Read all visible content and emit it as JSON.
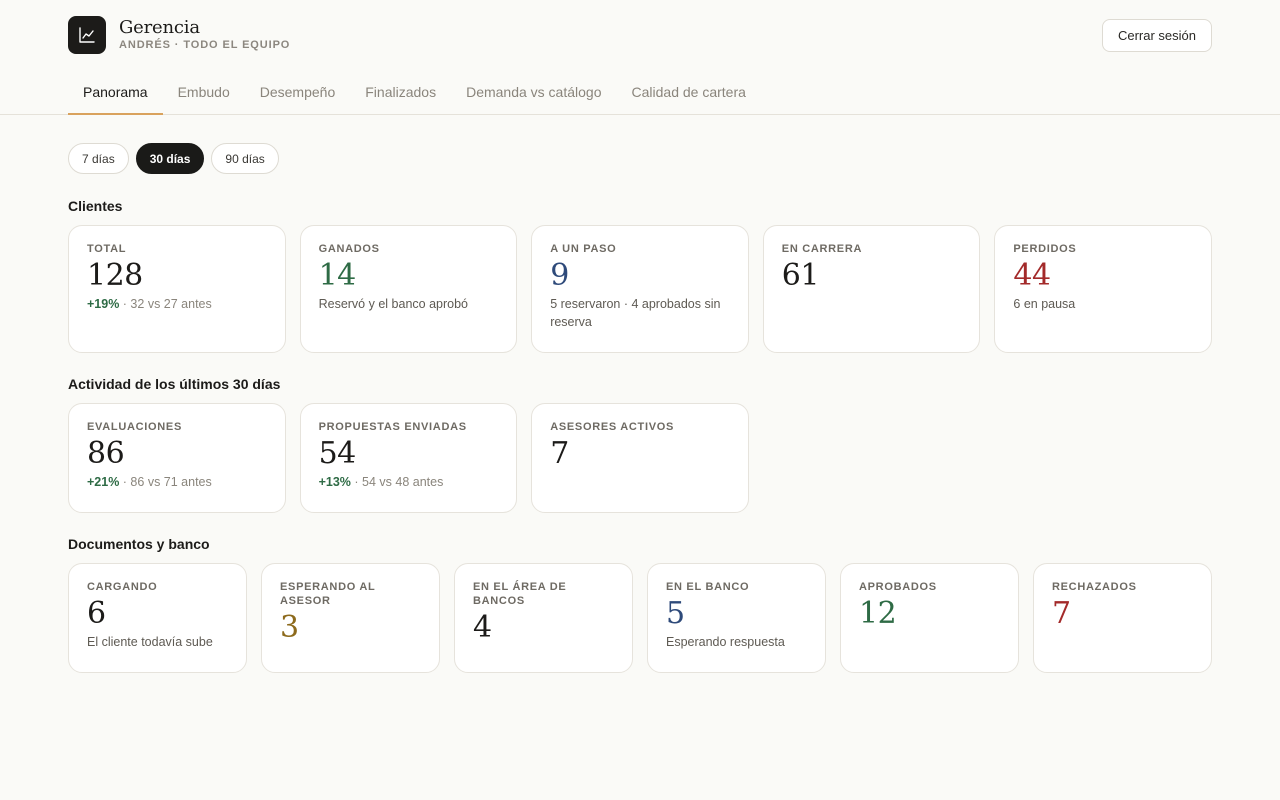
{
  "header": {
    "title": "Gerencia",
    "subtitle": "ANDRÉS · TODO EL EQUIPO",
    "logo_icon": "line-chart-icon",
    "logout_label": "Cerrar sesión"
  },
  "tabs": [
    {
      "label": "Panorama",
      "active": true
    },
    {
      "label": "Embudo",
      "active": false
    },
    {
      "label": "Desempeño",
      "active": false
    },
    {
      "label": "Finalizados",
      "active": false
    },
    {
      "label": "Demanda vs catálogo",
      "active": false
    },
    {
      "label": "Calidad de cartera",
      "active": false
    }
  ],
  "ranges": [
    {
      "label": "7 días",
      "active": false
    },
    {
      "label": "30 días",
      "active": true
    },
    {
      "label": "90 días",
      "active": false
    }
  ],
  "clientes": {
    "title": "Clientes",
    "cards": [
      {
        "label": "TOTAL",
        "value": "128",
        "delta": "+19%",
        "detail": " · 32 vs 27 antes"
      },
      {
        "label": "GANADOS",
        "value": "14",
        "note": "Reservó y el banco aprobó"
      },
      {
        "label": "A UN PASO",
        "value": "9",
        "note": "5 reservaron · 4 aprobados sin reserva"
      },
      {
        "label": "EN CARRERA",
        "value": "61"
      },
      {
        "label": "PERDIDOS",
        "value": "44",
        "note": "6 en pausa"
      }
    ]
  },
  "actividad": {
    "title": "Actividad de los últimos 30 días",
    "cards": [
      {
        "label": "EVALUACIONES",
        "value": "86",
        "delta": "+21%",
        "detail": " · 86 vs 71 antes"
      },
      {
        "label": "PROPUESTAS ENVIADAS",
        "value": "54",
        "delta": "+13%",
        "detail": " · 54 vs 48 antes"
      },
      {
        "label": "ASESORES ACTIVOS",
        "value": "7"
      }
    ]
  },
  "documentos": {
    "title": "Documentos y banco",
    "cards": [
      {
        "label": "CARGANDO",
        "value": "6",
        "note": "El cliente todavía sube"
      },
      {
        "label": "ESPERANDO AL ASESOR",
        "value": "3"
      },
      {
        "label": "EN EL ÁREA DE BANCOS",
        "value": "4"
      },
      {
        "label": "EN EL BANCO",
        "value": "5",
        "note": "Esperando respuesta"
      },
      {
        "label": "APROBADOS",
        "value": "12"
      },
      {
        "label": "RECHAZADOS",
        "value": "7"
      }
    ]
  },
  "colors": {
    "positive": "#2e6b45",
    "info": "#2e4a7a",
    "negative": "#a32a2a",
    "warning": "#8d6a1c",
    "tab_underline": "#d9a25d"
  }
}
